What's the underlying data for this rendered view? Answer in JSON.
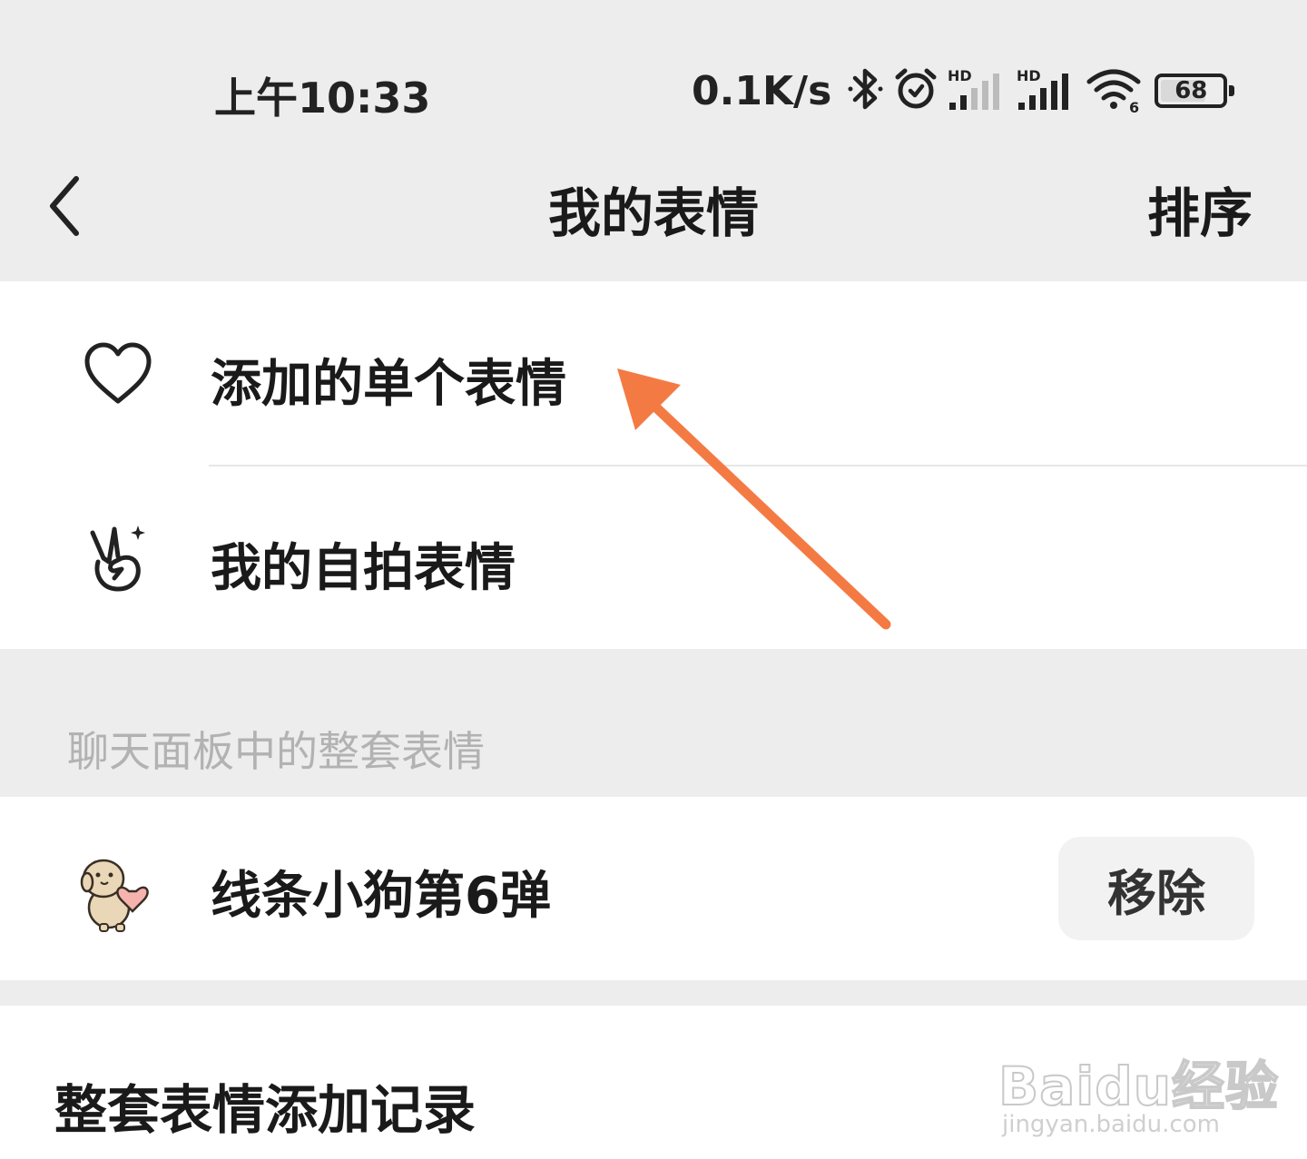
{
  "status_bar": {
    "time": "上午10:33",
    "net_speed": "0.1K/s",
    "battery_level": "68",
    "icons": [
      "bluetooth-icon",
      "alarm-icon",
      "hd-signal-icon",
      "hd-signal-icon",
      "wifi-icon",
      "battery-icon"
    ]
  },
  "nav": {
    "title": "我的表情",
    "sort_label": "排序"
  },
  "single": {
    "items": [
      {
        "label": "添加的单个表情",
        "icon": "heart-icon"
      },
      {
        "label": "我的自拍表情",
        "icon": "victory-hand-icon"
      }
    ]
  },
  "panel_section": {
    "title": "聊天面板中的整套表情",
    "packs": [
      {
        "name": "线条小狗第6弹",
        "action_label": "移除",
        "icon": "dog-sticker-icon"
      }
    ]
  },
  "history": {
    "label": "整套表情添加记录"
  },
  "annotation": {
    "arrow_color": "#f47a44"
  },
  "watermark": {
    "brand": "Baidu经验",
    "url": "jingyan.baidu.com"
  }
}
